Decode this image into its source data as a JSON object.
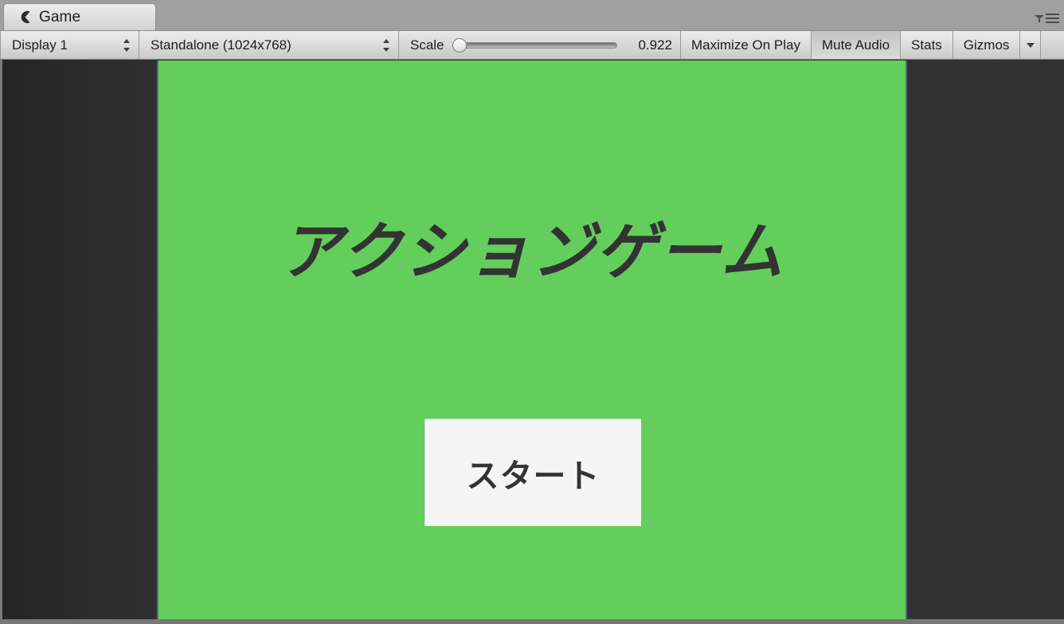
{
  "window": {
    "tab": {
      "label": "Game",
      "icon": "game-pacman-icon"
    },
    "panel_menu": {
      "filter_icon": "filter-icon",
      "menu_icon": "hamburger-menu-icon"
    }
  },
  "toolbar": {
    "display_selector": {
      "value": "Display 1",
      "icon": "updown-arrows-icon"
    },
    "aspect_selector": {
      "value": "Standalone (1024x768)",
      "icon": "updown-arrows-icon"
    },
    "scale": {
      "label": "Scale",
      "value": "0.922",
      "slider_position_percent": 0
    },
    "buttons": [
      {
        "label": "Maximize On Play",
        "name": "maximize-on-play-button",
        "pressed": false
      },
      {
        "label": "Mute Audio",
        "name": "mute-audio-button",
        "pressed": false
      },
      {
        "label": "Stats",
        "name": "stats-button",
        "pressed": false
      },
      {
        "label": "Gizmos",
        "name": "gizmos-button",
        "pressed": false
      }
    ],
    "gizmos_dropdown_icon": "caret-down-icon"
  },
  "game": {
    "background_color": "#63ce5b",
    "letterbox_color": "#323232",
    "title": "アクション゙ゲーム",
    "start_button": {
      "label": "スタート",
      "background_color": "#f5f5f5",
      "text_color": "#333333"
    }
  },
  "colors": {
    "chrome": "#a0a0a0",
    "toolbar": "#d5d5d5",
    "accent_green": "#63ce5b",
    "dark_gray": "#323232"
  }
}
